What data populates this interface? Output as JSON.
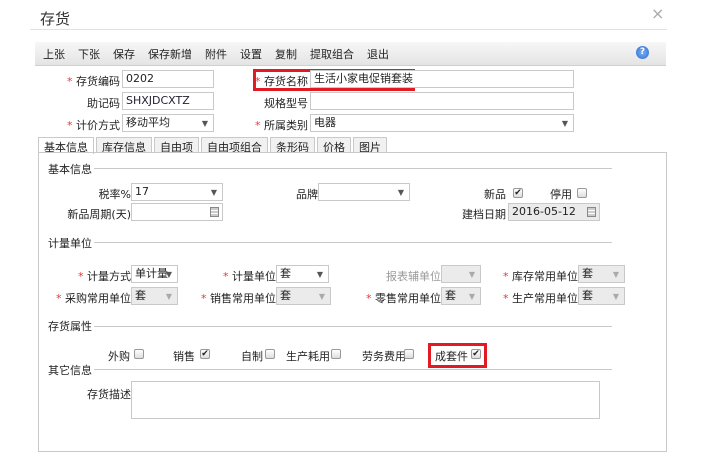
{
  "window": {
    "title": "存货",
    "close": "×"
  },
  "toolbar": [
    "上张",
    "下张",
    "保存",
    "保存新增",
    "附件",
    "设置",
    "复制",
    "提取组合",
    "退出"
  ],
  "help": "?",
  "header": {
    "code_label": "存货编码",
    "code": "0202",
    "name_label": "存货名称",
    "name": "生活小家电促销套装",
    "mnemonic_label": "助记码",
    "mnemonic": "SHXJDCXTZ",
    "spec_label": "规格型号",
    "spec": "",
    "pricing_label": "计价方式",
    "pricing": "移动平均",
    "category_label": "所属类别",
    "category": "电器"
  },
  "tabs": [
    "基本信息",
    "库存信息",
    "自由项",
    "自由项组合",
    "条形码",
    "价格",
    "图片"
  ],
  "basic": {
    "section": "基本信息",
    "tax_label": "税率%",
    "tax": "17",
    "brand_label": "品牌",
    "brand": "",
    "new_label": "新品",
    "new_checked": true,
    "disabled_label": "停用",
    "disabled_checked": false,
    "new_period_label": "新品周期(天)",
    "new_period": "",
    "created_label": "建档日期",
    "created": "2016-05-12"
  },
  "units": {
    "section": "计量单位",
    "measure_mode_label": "计量方式",
    "measure_mode": "单计量",
    "unit_label": "计量单位",
    "unit": "套",
    "report_unit_label": "报表辅单位",
    "report_unit": "",
    "stock_unit_label": "库存常用单位",
    "stock_unit": "套",
    "purchase_unit_label": "采购常用单位",
    "purchase_unit": "套",
    "sales_unit_label": "销售常用单位",
    "sales_unit": "套",
    "retail_unit_label": "零售常用单位",
    "retail_unit": "套",
    "production_unit_label": "生产常用单位",
    "production_unit": "套"
  },
  "attributes": {
    "section": "存货属性",
    "items": [
      {
        "label": "外购",
        "checked": false
      },
      {
        "label": "销售",
        "checked": true
      },
      {
        "label": "自制",
        "checked": false
      },
      {
        "label": "生产耗用",
        "checked": false
      },
      {
        "label": "劳务费用",
        "checked": false
      },
      {
        "label": "成套件",
        "checked": true
      }
    ]
  },
  "other": {
    "section": "其它信息",
    "desc_label": "存货描述",
    "desc": ""
  },
  "check": "✔"
}
